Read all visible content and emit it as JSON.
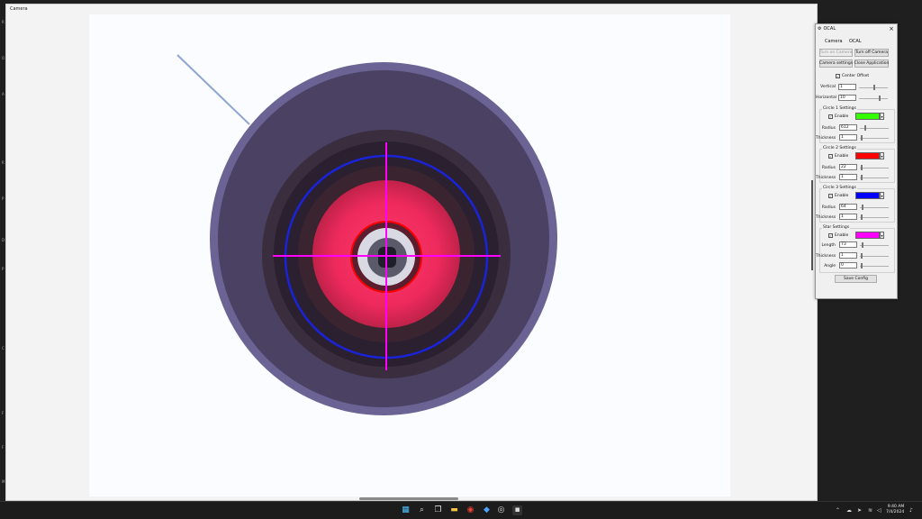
{
  "camera_window": {
    "title": "Camera"
  },
  "ocal": {
    "title": "OCAL",
    "tabs": [
      "Camera",
      "OCAL"
    ],
    "buttons": {
      "turn_on": "Turn on Camera",
      "turn_off": "Turn off Camera",
      "settings": "Camera settings",
      "close_app": "Close Application",
      "save": "Save Config"
    },
    "center_offset": {
      "label": "Center Offset",
      "checked": true,
      "vertical_label": "Vertical",
      "vertical": "1",
      "horizontal_label": "Horizontal",
      "horizontal": "10"
    },
    "circle1": {
      "title": "Circle 1 Settings",
      "enable": "Enable",
      "color": "#33ff00",
      "radius_label": "Radius",
      "radius": "612",
      "thickness_label": "Thickness",
      "thickness": "1"
    },
    "circle2": {
      "title": "Circle 2 Settings",
      "enable": "Enable",
      "color": "#ff0000",
      "radius_label": "Radius",
      "radius": "22",
      "thickness_label": "Thickness",
      "thickness": "1"
    },
    "circle3": {
      "title": "Circle 3 Settings",
      "enable": "Enable",
      "color": "#0000ff",
      "radius_label": "Radius",
      "radius": "64",
      "thickness_label": "Thickness",
      "thickness": "1"
    },
    "star": {
      "title": "Star Settings",
      "enable": "Enable",
      "color": "#ff00ff",
      "length_label": "Length",
      "length": "73",
      "thickness_label": "Thickness",
      "thickness": "1",
      "angle_label": "Angle",
      "angle": "0"
    }
  },
  "taskbar": {
    "icons": [
      "windows-start-icon",
      "search-icon",
      "task-view-icon",
      "file-explorer-icon",
      "chrome-icon",
      "app-icon",
      "app-icon-2",
      "camera-app-icon"
    ],
    "time": "9:40 AM",
    "date": "7/4/2024"
  }
}
